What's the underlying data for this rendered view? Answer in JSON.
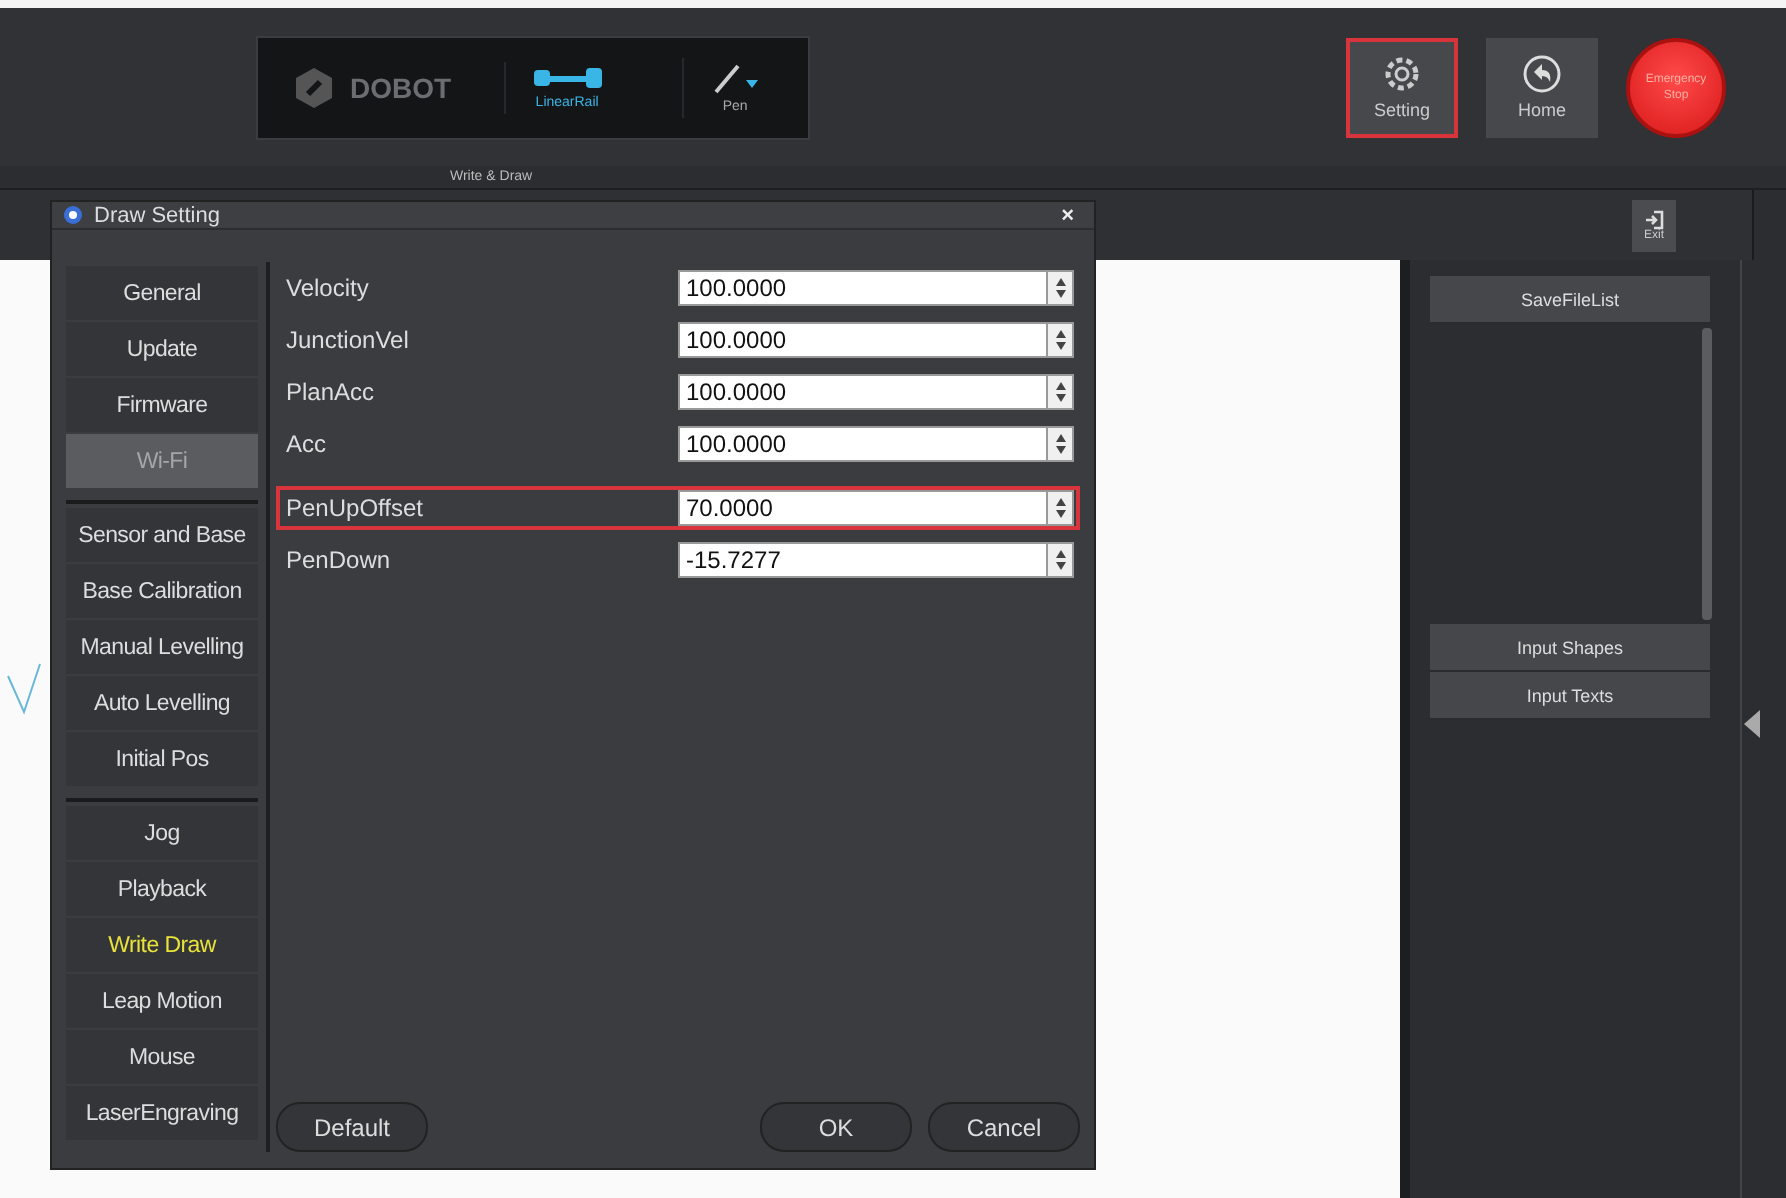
{
  "header": {
    "logo": "DOBOT",
    "tools": [
      {
        "label": "LinearRail",
        "kind": "rail",
        "selected": true
      },
      {
        "label": "Pen",
        "kind": "pen",
        "selected": false
      }
    ],
    "mode": "Write & Draw",
    "buttons": [
      {
        "label": "Setting",
        "kind": "gear",
        "highlighted": true
      },
      {
        "label": "Home",
        "kind": "home",
        "highlighted": false
      }
    ],
    "emergency": "Emergency Stop"
  },
  "toolbar": {
    "exit": "Exit"
  },
  "side_panel": {
    "top_button": "SaveFileList",
    "bottom_buttons": [
      "Input Shapes",
      "Input Texts"
    ]
  },
  "dialog": {
    "title": "Draw Setting",
    "close": "×",
    "nav_groups": [
      [
        {
          "label": "General",
          "selected": false,
          "disabled": false
        },
        {
          "label": "Update",
          "selected": false,
          "disabled": false
        },
        {
          "label": "Firmware",
          "selected": false,
          "disabled": false
        },
        {
          "label": "Wi-Fi",
          "selected": false,
          "disabled": true
        }
      ],
      [
        {
          "label": "Sensor and Base",
          "selected": false,
          "disabled": false
        },
        {
          "label": "Base Calibration",
          "selected": false,
          "disabled": false
        },
        {
          "label": "Manual Levelling",
          "selected": false,
          "disabled": false
        },
        {
          "label": "Auto Levelling",
          "selected": false,
          "disabled": false
        },
        {
          "label": "Initial Pos",
          "selected": false,
          "disabled": false
        }
      ],
      [
        {
          "label": "Jog",
          "selected": false,
          "disabled": false
        },
        {
          "label": "Playback",
          "selected": false,
          "disabled": false
        },
        {
          "label": "Write  Draw",
          "selected": true,
          "disabled": false
        },
        {
          "label": "Leap Motion",
          "selected": false,
          "disabled": false
        },
        {
          "label": "Mouse",
          "selected": false,
          "disabled": false
        },
        {
          "label": "LaserEngraving",
          "selected": false,
          "disabled": false
        }
      ]
    ],
    "fields": [
      {
        "label": "Velocity",
        "value": "100.0000",
        "highlighted": false
      },
      {
        "label": "JunctionVel",
        "value": "100.0000",
        "highlighted": false
      },
      {
        "label": "PlanAcc",
        "value": "100.0000",
        "highlighted": false
      },
      {
        "label": "Acc",
        "value": "100.0000",
        "highlighted": false
      },
      {
        "label": "PenUpOffset",
        "value": "70.0000",
        "highlighted": true
      },
      {
        "label": "PenDown",
        "value": "-15.7277",
        "highlighted": false
      }
    ],
    "left_button": "Default",
    "right_buttons": [
      "OK",
      "Cancel"
    ]
  }
}
